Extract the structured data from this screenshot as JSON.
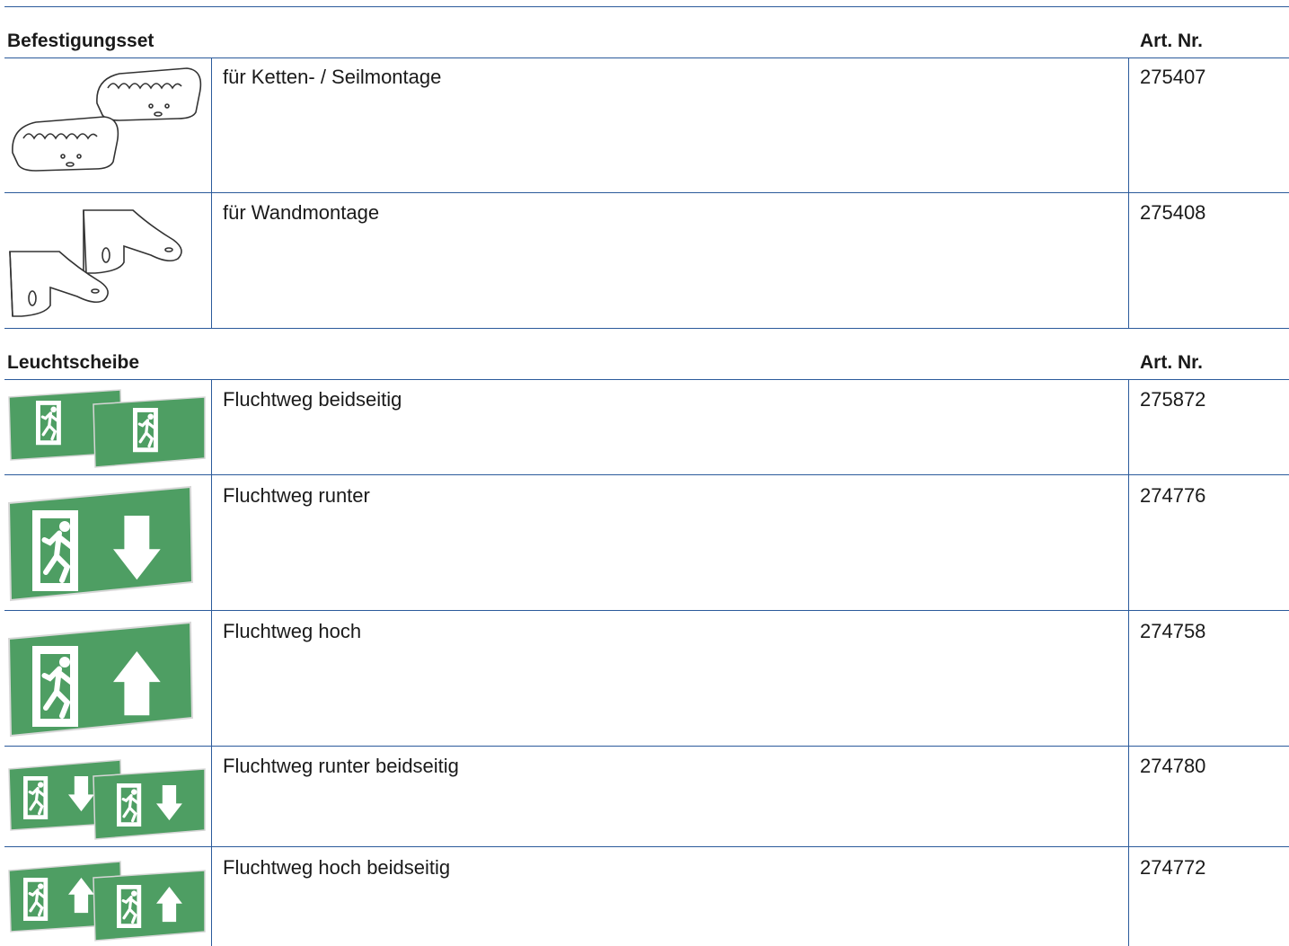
{
  "sections": [
    {
      "title": "Befestigungsset",
      "artnr_label": "Art. Nr.",
      "rows": [
        {
          "icon": "chain-mount-bracket-icon",
          "description": "für Ketten- / Seilmontage",
          "number": "275407"
        },
        {
          "icon": "wall-mount-bracket-icon",
          "description": "für Wandmontage",
          "number": "275408"
        }
      ]
    },
    {
      "title": "Leuchtscheibe",
      "artnr_label": "Art. Nr.",
      "rows": [
        {
          "icon": "exit-sign-double-icon",
          "description": "Fluchtweg beidseitig",
          "number": "275872"
        },
        {
          "icon": "exit-sign-down-arrow-icon",
          "description": "Fluchtweg runter",
          "number": "274776"
        },
        {
          "icon": "exit-sign-up-arrow-icon",
          "description": "Fluchtweg hoch",
          "number": "274758"
        },
        {
          "icon": "exit-sign-down-arrow-double-icon",
          "description": "Fluchtweg runter beidseitig",
          "number": "274780"
        },
        {
          "icon": "exit-sign-up-arrow-double-icon",
          "description": "Fluchtweg hoch beidseitig",
          "number": "274772"
        }
      ]
    }
  ],
  "colors": {
    "rule": "#2b5a9b",
    "sign_green": "#4e9e63"
  }
}
